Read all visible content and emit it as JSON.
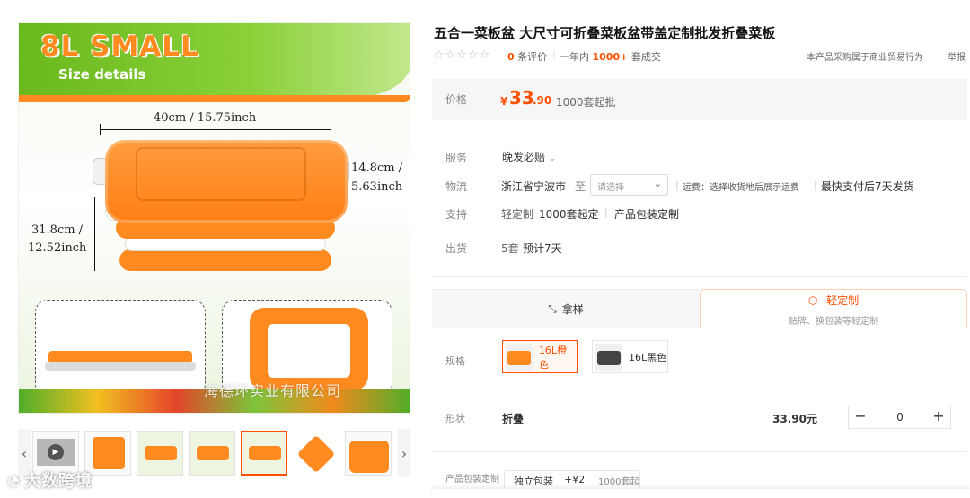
{
  "hero": {
    "title": "8L SMALL",
    "subtitle": "Size details",
    "dim_width": "40cm / 15.75inch",
    "dim_height": "14.8cm /",
    "dim_height2": "5.63inch",
    "dim_depth": "31.8cm /",
    "dim_depth2": "12.52inch",
    "watermark": "海德环实业有限公司"
  },
  "product": {
    "title": "五合一菜板盆 大尺寸可折叠菜板盆带盖定制批发折叠菜板",
    "review_count": "0",
    "review_label": "条评价",
    "year_label": "一年内",
    "sales_count": "1000+",
    "sales_label": "套成交",
    "purchase_note": "本产品采购属于商业贸易行为",
    "report": "举报"
  },
  "price": {
    "label": "价格",
    "currency": "¥",
    "integer": "33",
    "decimal": ".90",
    "moq": "1000套起批"
  },
  "service": {
    "label": "服务",
    "value": "晚发必赔"
  },
  "logistics": {
    "label": "物流",
    "origin": "浙江省宁波市",
    "to": "至",
    "select_placeholder": "请选择",
    "fee_note": "运费：选择收货地后展示运费",
    "ship_note": "最快支付后7天发货"
  },
  "support": {
    "label": "支持",
    "light_custom": "轻定制",
    "light_custom_moq": "1000套起定",
    "pkg_custom": "产品包装定制"
  },
  "shipping": {
    "label": "出货",
    "qty": "5套",
    "eta": "预计7天"
  },
  "tabs": {
    "sample": "拿样",
    "custom": "轻定制",
    "custom_sub": "贴牌、换包装等轻定制"
  },
  "spec": {
    "label": "规格",
    "options": [
      "16L橙色",
      "16L黑色"
    ]
  },
  "shape": {
    "label": "形状",
    "value": "折叠",
    "price": "33.90元",
    "qty": "0"
  },
  "packaging": {
    "label": "产品包装定制",
    "option": "独立包装",
    "add_price": "+¥2",
    "moq": "1000套起"
  },
  "brand_watermark": "大数跨境",
  "colors": {
    "accent": "#ff5000",
    "product_orange": "#ff8a1f",
    "banner_green": "#6ab81e"
  }
}
